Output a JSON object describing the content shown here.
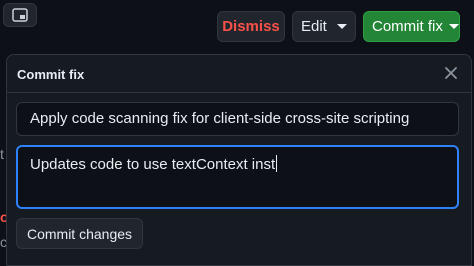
{
  "header": {
    "dismiss_label": "Dismiss",
    "edit_label": "Edit",
    "commit_fix_label": "Commit fix"
  },
  "background": {
    "frag_t": "t",
    "frag_o": "o",
    "frag_c": "c"
  },
  "popover": {
    "title": "Commit fix",
    "summary_value": "Apply code scanning fix for client-side cross-site scripting",
    "description_value": "Updates code to use textContext inst",
    "commit_changes_label": "Commit changes"
  },
  "icons": {
    "top_left": "window-icon",
    "close": "close-icon",
    "caret": "chevron-down-icon"
  },
  "colors": {
    "dismiss_text": "#f85149",
    "commit_fix_bg": "#238636",
    "focus_border": "#2f81f7"
  }
}
